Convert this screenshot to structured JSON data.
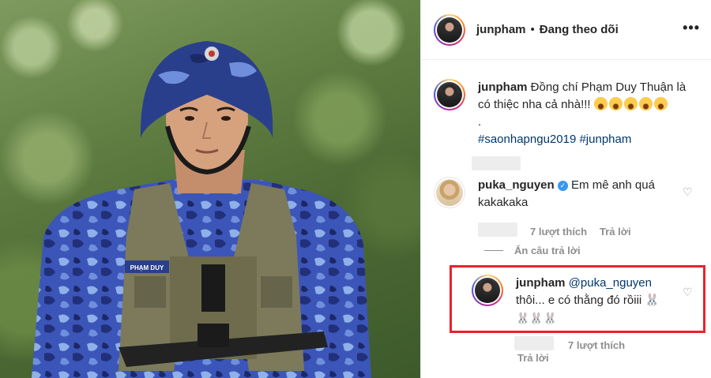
{
  "photo": {
    "name_tag": "PHẠM DUY",
    "alt": "Soldier in blue camouflage uniform and helmet"
  },
  "header": {
    "username": "junpham",
    "separator": "•",
    "follow_status": "Đang theo dõi",
    "more": "•••"
  },
  "caption": {
    "username": "junpham",
    "text": "Đồng chí Phạm Duy Thuận là có thiệc nha cả nhà!!!",
    "emoji_count": 5,
    "dot": ".",
    "hashtags": "#saonhapngu2019 #junpham"
  },
  "comment": {
    "username": "puka_nguyen",
    "verified_icon": "verified-badge",
    "text": "Em mê anh quá kakakaka",
    "likes": "7 lượt thích",
    "reply": "Trả lời",
    "hide_replies": "Ẩn câu trả lời"
  },
  "reply": {
    "username": "junpham",
    "mention": "@puka_nguyen",
    "text": "thôi... e có thằng đó rồiii 🐰",
    "emojis": "🐰🐰🐰",
    "likes": "7 lượt thích",
    "reply": "Trả lời"
  },
  "colors": {
    "highlight_border": "#e8232b",
    "link": "#00376b",
    "muted": "#8e8e8e"
  }
}
